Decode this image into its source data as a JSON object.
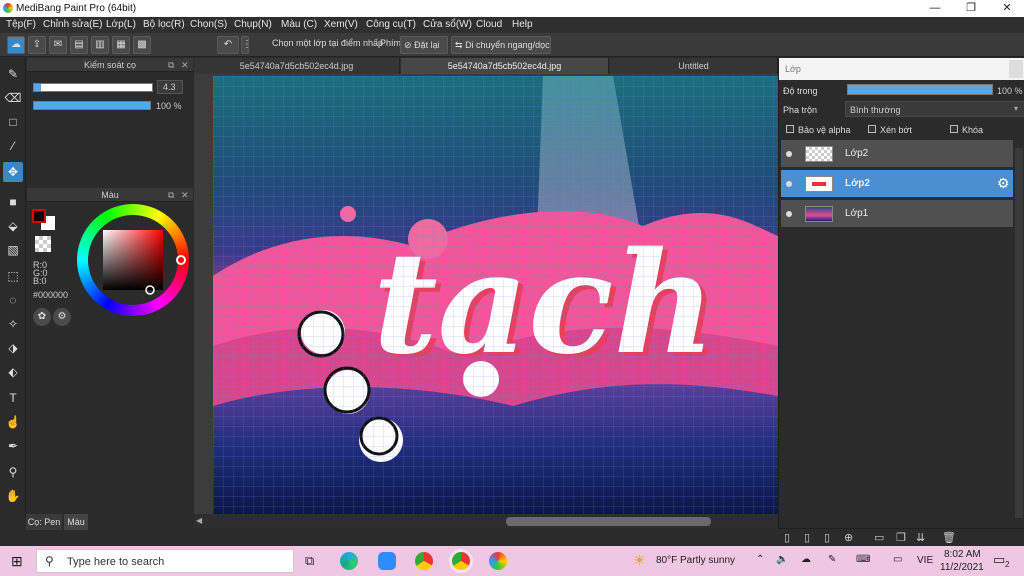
{
  "window": {
    "title": "MediBang Paint Pro (64bit)",
    "minimize": "—",
    "restore": "❐",
    "close": "✕"
  },
  "menu": [
    "Tệp(F)",
    "Chỉnh sửa(E)",
    "Lớp(L)",
    "Bộ lọc(R)",
    "Chọn(S)",
    "Chụp(N)",
    "Màu (C)",
    "Xem(V)",
    "Công cụ(T)",
    "Cửa sổ(W)",
    "Cloud",
    "Help"
  ],
  "toolbar": {
    "select_layer_label": "Chọn một lớp tại điểm nhấp",
    "phim_label": "Phím",
    "reset_label": "Đặt lại",
    "flip_label": "Di chuyển ngang/dọc"
  },
  "brush_panel": {
    "title": "Kiểm soát cọ",
    "size": "4.3",
    "opacity": "100 %",
    "opacity_fraction": 1.0
  },
  "color_panel": {
    "title": "Màu",
    "r": "R:0",
    "g": "G:0",
    "b": "B:0",
    "hex": "#000000"
  },
  "bottom_tabs": [
    "Cọ: Pen",
    "Màu"
  ],
  "tabs": [
    "5e54740a7d5cb502ec4d.jpg",
    "5e54740a7d5cb502ec4d.jpg",
    "Untitled"
  ],
  "canvas": {
    "lettering": "tach"
  },
  "layer_panel": {
    "title": "Lớp",
    "opacity_label": "Độ trong",
    "opacity_value": "100 %",
    "opacity_fraction": 1.0,
    "blend_label": "Pha trộn",
    "blend_value": "Bình thường",
    "protect_alpha": "Bảo vệ alpha",
    "clipping": "Xén bớt",
    "lock": "Khóa",
    "layers": [
      {
        "name": "Lớp2",
        "selected": false
      },
      {
        "name": "Lớp2",
        "selected": true
      },
      {
        "name": "Lớp1",
        "selected": false
      }
    ]
  },
  "taskbar": {
    "search_placeholder": "Type here to search",
    "weather": "80°F  Partly sunny",
    "lang": "VIE",
    "time": "8:02 AM",
    "date": "11/2/2021",
    "notifications": "2"
  },
  "colors": {
    "accent": "#3b86c6",
    "taskbar": "#f0c7e2"
  }
}
